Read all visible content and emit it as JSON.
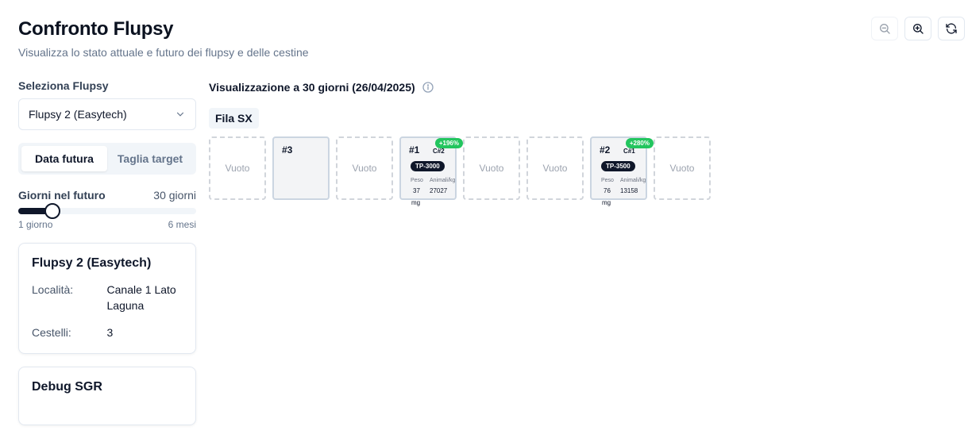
{
  "header": {
    "title": "Confronto Flupsy",
    "subtitle": "Visualizza lo stato attuale e futuro dei flupsy e delle cestine"
  },
  "toolbar": {
    "zoom_out_icon": "zoom-out-icon",
    "zoom_in_icon": "zoom-in-icon",
    "refresh_icon": "refresh-icon"
  },
  "sidebar": {
    "select_label": "Seleziona Flupsy",
    "select_value": "Flupsy 2 (Easytech)",
    "tabs": [
      {
        "label": "Data futura",
        "active": true
      },
      {
        "label": "Taglia target",
        "active": false
      }
    ],
    "slider": {
      "label": "Giorni nel futuro",
      "value_text": "30 giorni",
      "min_label": "1 giorno",
      "max_label": "6 mesi",
      "value_days": 30
    },
    "info_card": {
      "title": "Flupsy 2 (Easytech)",
      "rows": [
        {
          "key": "Località:",
          "value": "Canale 1 Lato Laguna"
        },
        {
          "key": "Cestelli:",
          "value": "3"
        }
      ]
    },
    "debug_card": {
      "title": "Debug SGR"
    }
  },
  "main": {
    "view_title": "Visualizzazione a 30 giorni (26/04/2025)",
    "row_label": "Fila SX",
    "empty_label": "Vuoto",
    "baskets": [
      {
        "number": "#3"
      },
      {
        "number": "#1",
        "cycle": "C#2",
        "growth": "+196%",
        "size": "TP-3000",
        "weight_label": "Peso",
        "weight": "37",
        "weight_unit": "mg",
        "animals_label": "Animali/kg",
        "animals": "27027"
      },
      {
        "number": "#2",
        "cycle": "C#1",
        "growth": "+280%",
        "size": "TP-3500",
        "weight_label": "Peso",
        "weight": "76",
        "weight_unit": "mg",
        "animals_label": "Animali/kg",
        "animals": "13158"
      }
    ]
  },
  "colors": {
    "accent": "#0f172a",
    "growth_badge": "#22c55e",
    "empty_border": "#d1d5db"
  }
}
